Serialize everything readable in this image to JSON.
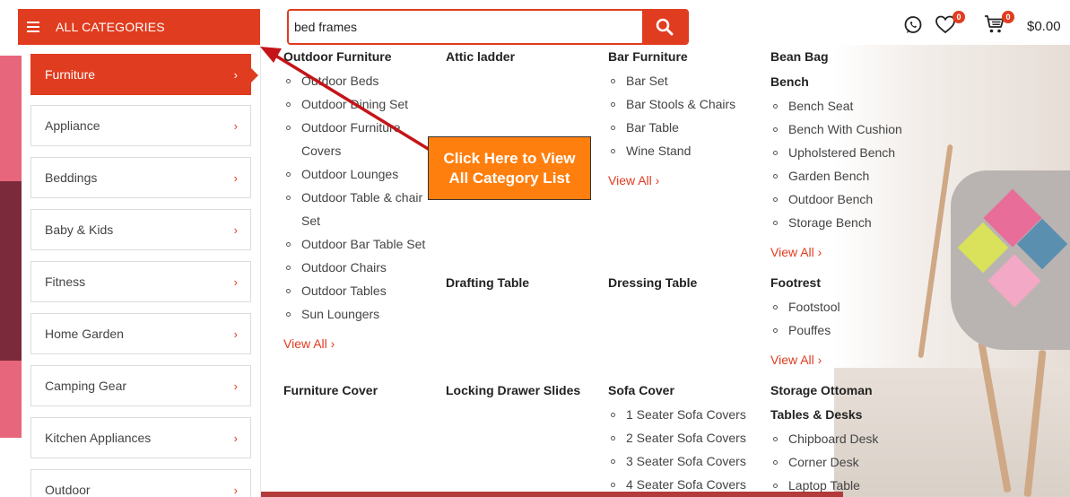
{
  "header": {
    "all_categories_label": "ALL CATEGORIES",
    "search_value": "bed frames",
    "wishlist_count": "0",
    "cart_count": "0",
    "cart_total": "$0.00"
  },
  "sidebar": {
    "items": [
      {
        "label": "Furniture",
        "active": true
      },
      {
        "label": "Appliance"
      },
      {
        "label": "Beddings"
      },
      {
        "label": "Baby & Kids"
      },
      {
        "label": "Fitness"
      },
      {
        "label": "Home Garden"
      },
      {
        "label": "Camping Gear"
      },
      {
        "label": "Kitchen Appliances"
      },
      {
        "label": "Outdoor"
      }
    ]
  },
  "mega": {
    "view_all": "View All",
    "outdoor_furniture": {
      "title": "Outdoor Furniture",
      "items": [
        "Outdoor Beds",
        "Outdoor Dining Set",
        "Outdoor Furniture Covers",
        "Outdoor Lounges",
        "Outdoor Table & chair Set",
        "Outdoor Bar Table Set",
        "Outdoor Chairs",
        "Outdoor Tables",
        "Sun Loungers"
      ]
    },
    "attic_ladder": {
      "title": "Attic ladder"
    },
    "bar_furniture": {
      "title": "Bar Furniture",
      "items": [
        "Bar Set",
        "Bar Stools & Chairs",
        "Bar Table",
        "Wine Stand"
      ]
    },
    "bean_bag": {
      "title": "Bean Bag"
    },
    "bench": {
      "title": "Bench",
      "items": [
        "Bench Seat",
        "Bench With Cushion",
        "Upholstered Bench",
        "Garden Bench",
        "Outdoor Bench",
        "Storage Bench"
      ]
    },
    "drafting_table": {
      "title": "Drafting Table"
    },
    "dressing_table": {
      "title": "Dressing Table"
    },
    "footrest": {
      "title": "Footrest",
      "items": [
        "Footstool",
        "Pouffes"
      ]
    },
    "furniture_cover": {
      "title": "Furniture Cover"
    },
    "locking_drawer_slides": {
      "title": "Locking Drawer Slides"
    },
    "sofa_cover": {
      "title": "Sofa Cover",
      "items": [
        "1 Seater Sofa Covers",
        "2 Seater Sofa Covers",
        "3 Seater Sofa Covers",
        "4 Seater Sofa Covers"
      ]
    },
    "storage_ottoman": {
      "title": "Storage Ottoman"
    },
    "tables_desks": {
      "title": "Tables & Desks",
      "items": [
        "Chipboard Desk",
        "Corner Desk",
        "Laptop Table"
      ]
    }
  },
  "annotation": {
    "line1": "Click Here to View",
    "line2": "All Category List"
  },
  "colors": {
    "accent": "#e03c1f",
    "annotation": "#ff7f0e"
  },
  "icons": {
    "menu": "hamburger-icon",
    "search": "search-icon",
    "whatsapp": "whatsapp-icon",
    "wishlist": "heart-icon",
    "cart": "cart-icon"
  }
}
